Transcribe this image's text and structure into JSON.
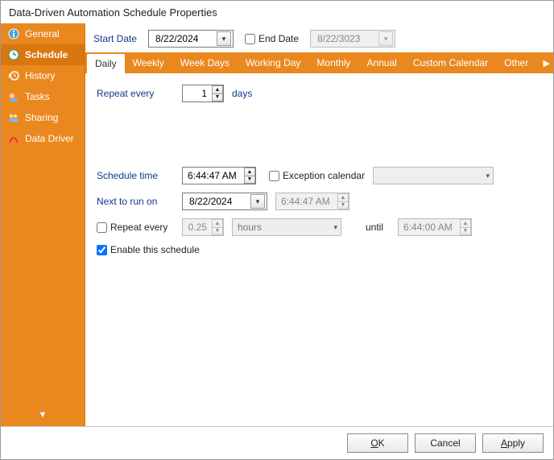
{
  "title": "Data-Driven Automation Schedule Properties",
  "sidebar": {
    "items": [
      {
        "label": "General"
      },
      {
        "label": "Schedule"
      },
      {
        "label": "History"
      },
      {
        "label": "Tasks"
      },
      {
        "label": "Sharing"
      },
      {
        "label": "Data Driver"
      }
    ]
  },
  "dates": {
    "start_label": "Start Date",
    "start_value": "8/22/2024",
    "end_label": "End Date",
    "end_value": "8/22/3023"
  },
  "tabs": [
    "Daily",
    "Weekly",
    "Week Days",
    "Working Day",
    "Monthly",
    "Annual",
    "Custom Calendar",
    "Other"
  ],
  "daily": {
    "repeat_label": "Repeat every",
    "repeat_value": "1",
    "repeat_unit": "days"
  },
  "schedule": {
    "time_label": "Schedule time",
    "time_value": "6:44:47 AM",
    "exception_label": "Exception calendar",
    "exception_value": "",
    "next_label": "Next to run on",
    "next_date": "8/22/2024",
    "next_time": "6:44:47 AM",
    "repeat_every_label": "Repeat every",
    "repeat_every_value": "0.25",
    "repeat_unit": "hours",
    "until_label": "until",
    "until_value": "6:44:00 AM",
    "enable_label": "Enable this schedule"
  },
  "buttons": {
    "ok": "OK",
    "cancel": "Cancel",
    "apply": "Apply"
  }
}
